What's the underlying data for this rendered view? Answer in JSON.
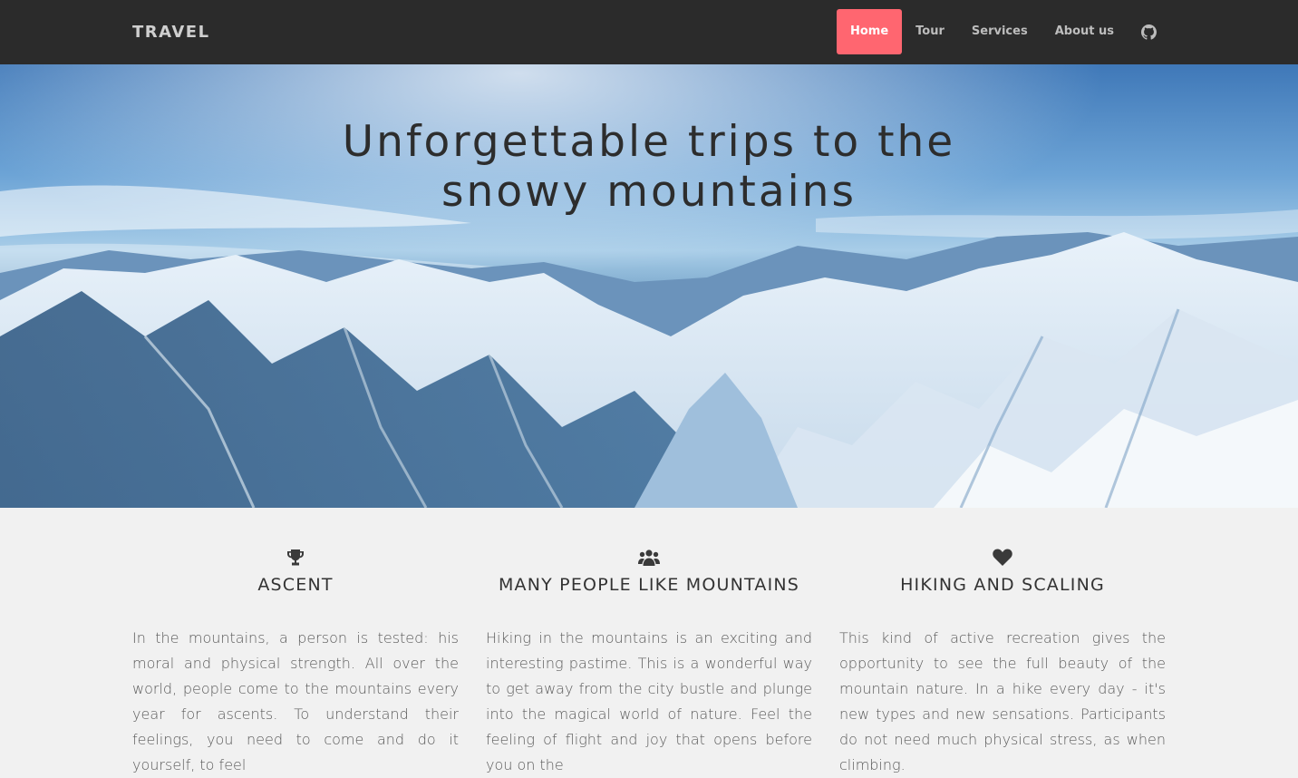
{
  "nav": {
    "brand": "TRAVEL",
    "items": [
      {
        "label": "Home",
        "active": true
      },
      {
        "label": "Tour",
        "active": false
      },
      {
        "label": "Services",
        "active": false
      },
      {
        "label": "About us",
        "active": false
      }
    ],
    "github_icon": "github-icon",
    "active_color": "#ff6670",
    "background": "#2b2b2b"
  },
  "hero": {
    "title_line1": "Unforgettable trips to the",
    "title_line2": "snowy mountains"
  },
  "features": [
    {
      "icon": "trophy-icon",
      "title": "ASCENT",
      "text": "In the mountains, a person is tested: his moral and physical strength. All over the world, people come to the mountains every year for ascents. To understand their feelings, you need to come and do it yourself, to feel"
    },
    {
      "icon": "users-icon",
      "title": "MANY PEOPLE LIKE MOUNTAINS",
      "text": "Hiking in the mountains is an exciting and interesting pastime. This is a wonderful way to get away from the city bustle and plunge into the magical world of nature. Feel the feeling of flight and joy that opens before you on the"
    },
    {
      "icon": "heart-icon",
      "title": "HIKING AND SCALING",
      "text": "This kind of active recreation gives the opportunity to see the full beauty of the mountain nature. In a hike every day - it's new types and new sensations. Participants do not need much physical stress, as when climbing."
    }
  ]
}
